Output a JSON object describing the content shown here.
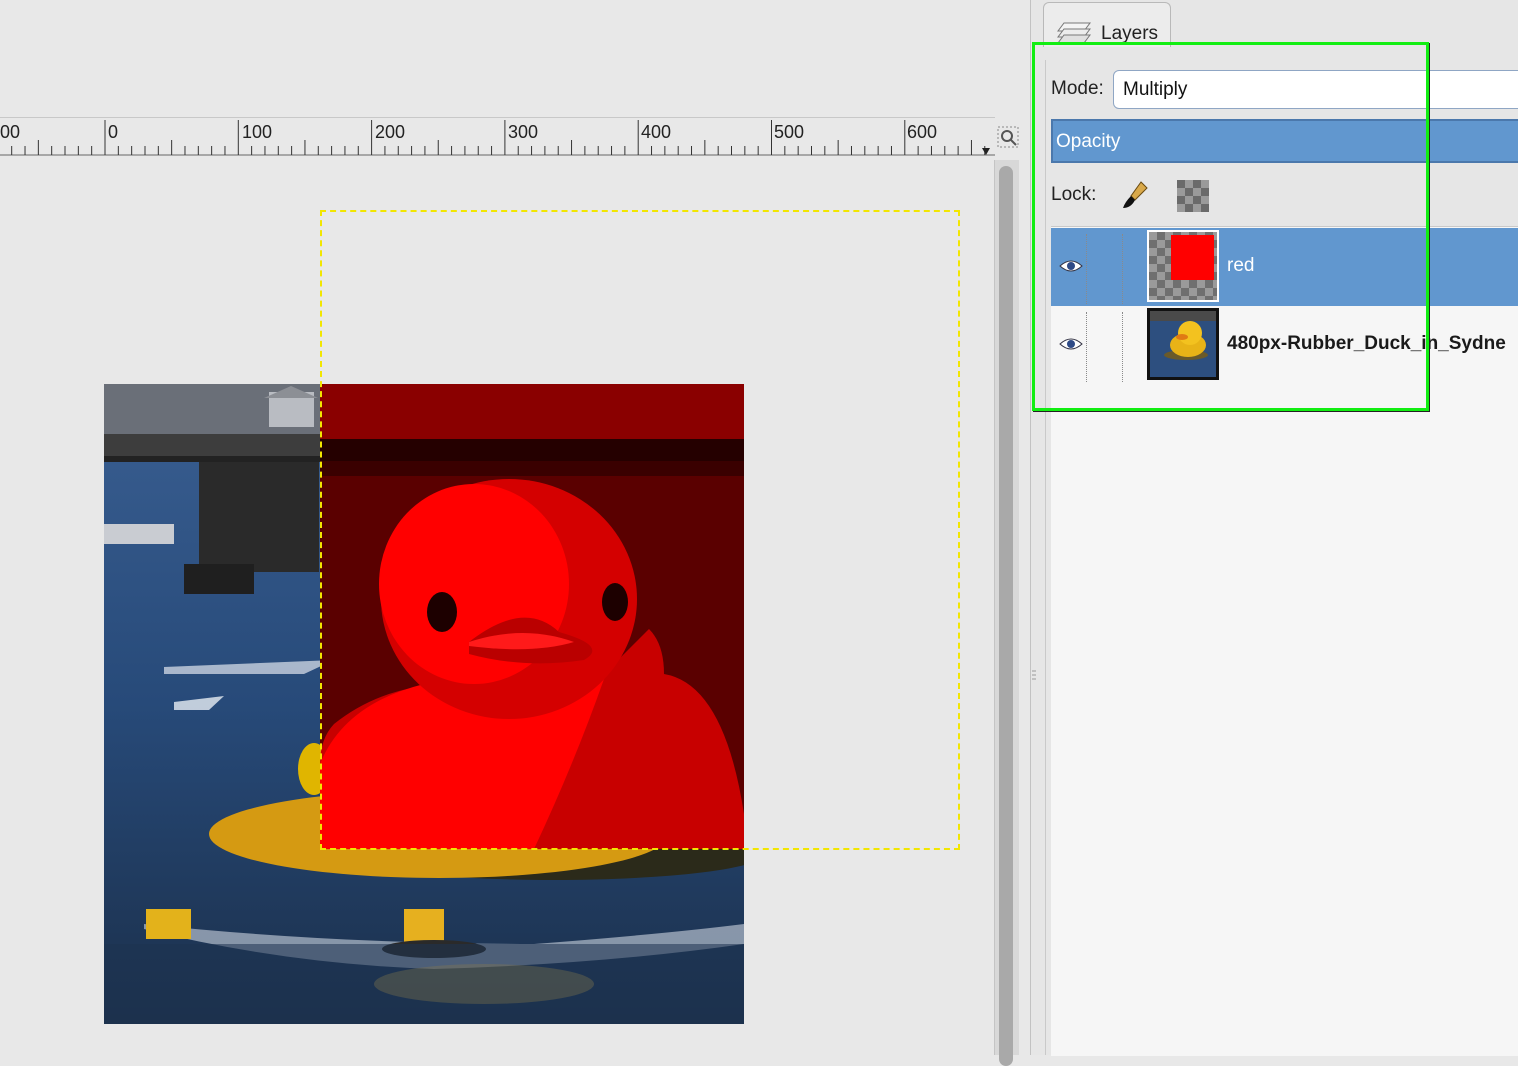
{
  "ruler": {
    "labels": [
      "00",
      "0",
      "100",
      "200",
      "300",
      "400",
      "500",
      "600"
    ]
  },
  "panel": {
    "tab_label": "Layers",
    "mode_label": "Mode:",
    "mode_value": "Multiply",
    "opacity_label": "Opacity",
    "lock_label": "Lock:"
  },
  "layers": [
    {
      "name": "red",
      "visible": true,
      "selected": true,
      "fill": "#ff0000"
    },
    {
      "name": "480px-Rubber_Duck_in_Sydne",
      "visible": true,
      "selected": false
    }
  ],
  "colors": {
    "selection": "#6197cf",
    "highlight_box": "#12ee12",
    "layer_boundary": "#f2e600",
    "red_layer": "#ff0000"
  },
  "icons": [
    "layers-tab-icon",
    "eye-icon",
    "brush-icon",
    "checker-icon",
    "navigate-icon"
  ]
}
